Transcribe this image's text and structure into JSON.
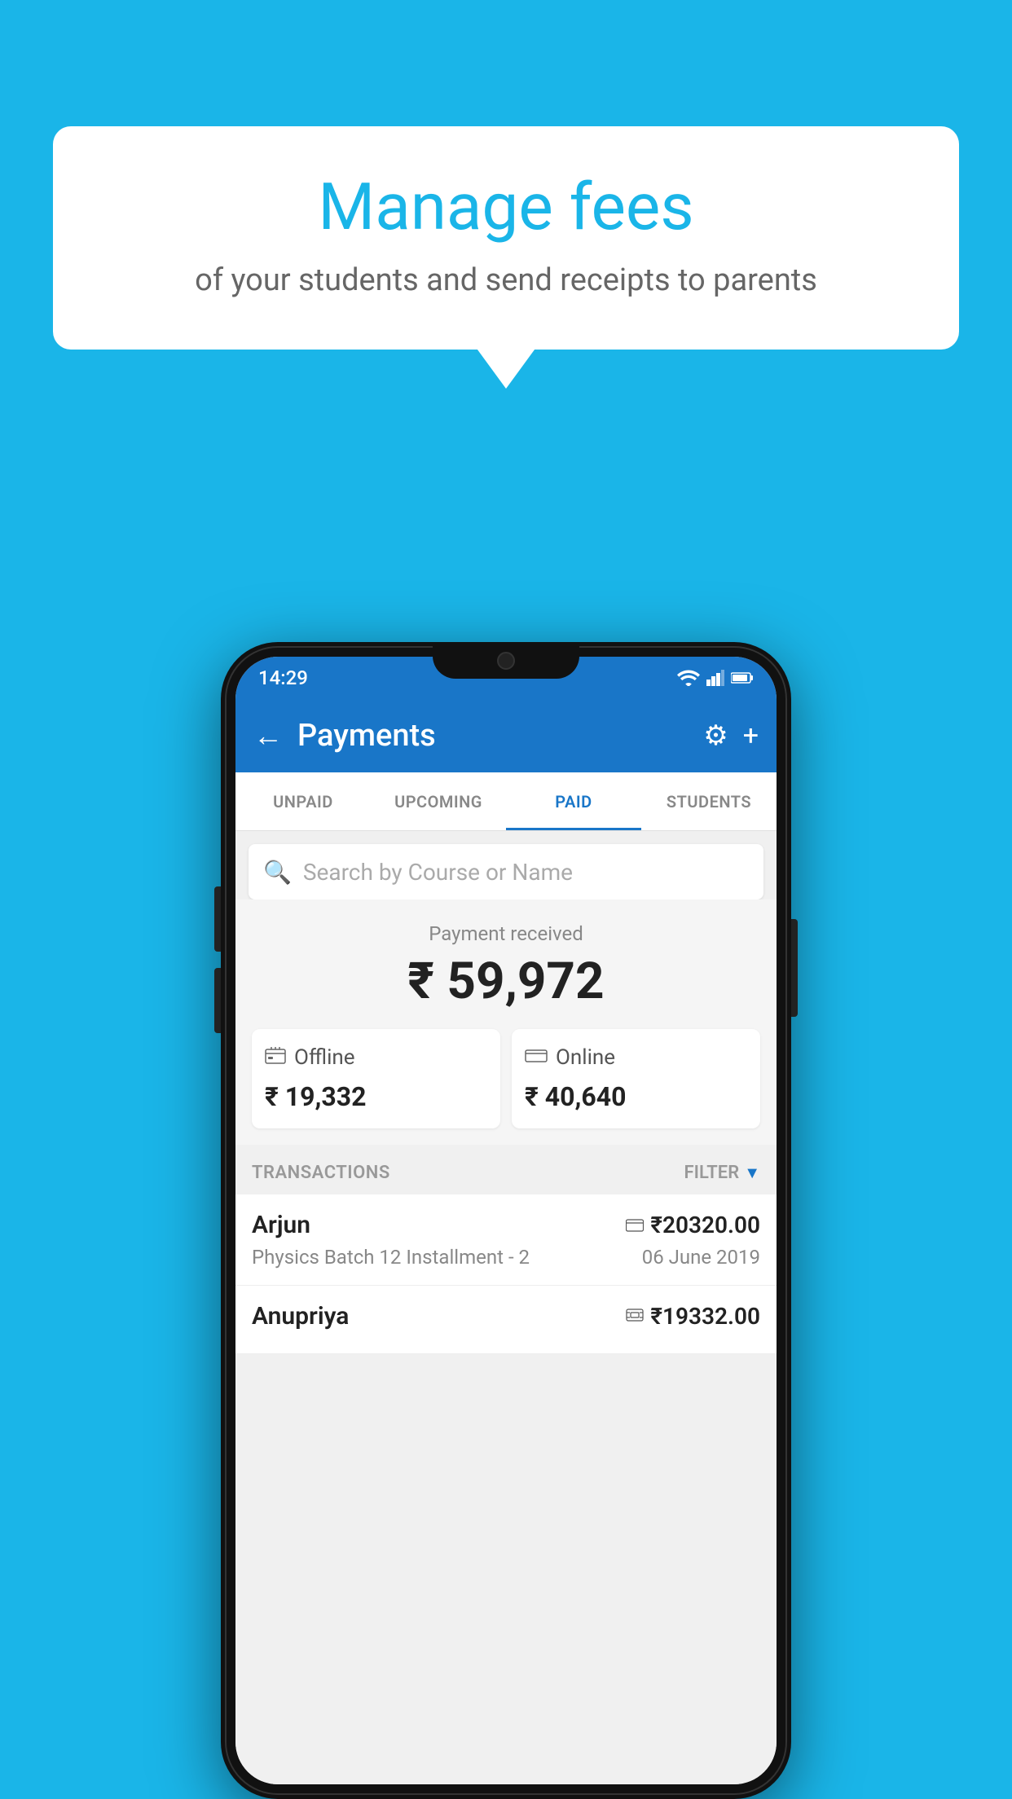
{
  "page": {
    "background_color": "#1ab5e8"
  },
  "speech_bubble": {
    "title": "Manage fees",
    "subtitle": "of your students and send receipts to parents"
  },
  "phone": {
    "status_bar": {
      "time": "14:29"
    },
    "top_bar": {
      "title": "Payments",
      "back_label": "←",
      "gear_label": "⚙",
      "plus_label": "+"
    },
    "tabs": [
      {
        "label": "UNPAID",
        "active": false
      },
      {
        "label": "UPCOMING",
        "active": false
      },
      {
        "label": "PAID",
        "active": true
      },
      {
        "label": "STUDENTS",
        "active": false
      }
    ],
    "search": {
      "placeholder": "Search by Course or Name"
    },
    "payment_summary": {
      "label": "Payment received",
      "amount": "₹ 59,972",
      "offline_label": "Offline",
      "offline_amount": "₹ 19,332",
      "online_label": "Online",
      "online_amount": "₹ 40,640"
    },
    "transactions": {
      "header_label": "TRANSACTIONS",
      "filter_label": "FILTER",
      "items": [
        {
          "name": "Arjun",
          "amount": "₹20320.00",
          "course": "Physics Batch 12 Installment - 2",
          "date": "06 June 2019",
          "icon_type": "card"
        },
        {
          "name": "Anupriya",
          "amount": "₹19332.00",
          "course": "",
          "date": "",
          "icon_type": "cash"
        }
      ]
    }
  }
}
